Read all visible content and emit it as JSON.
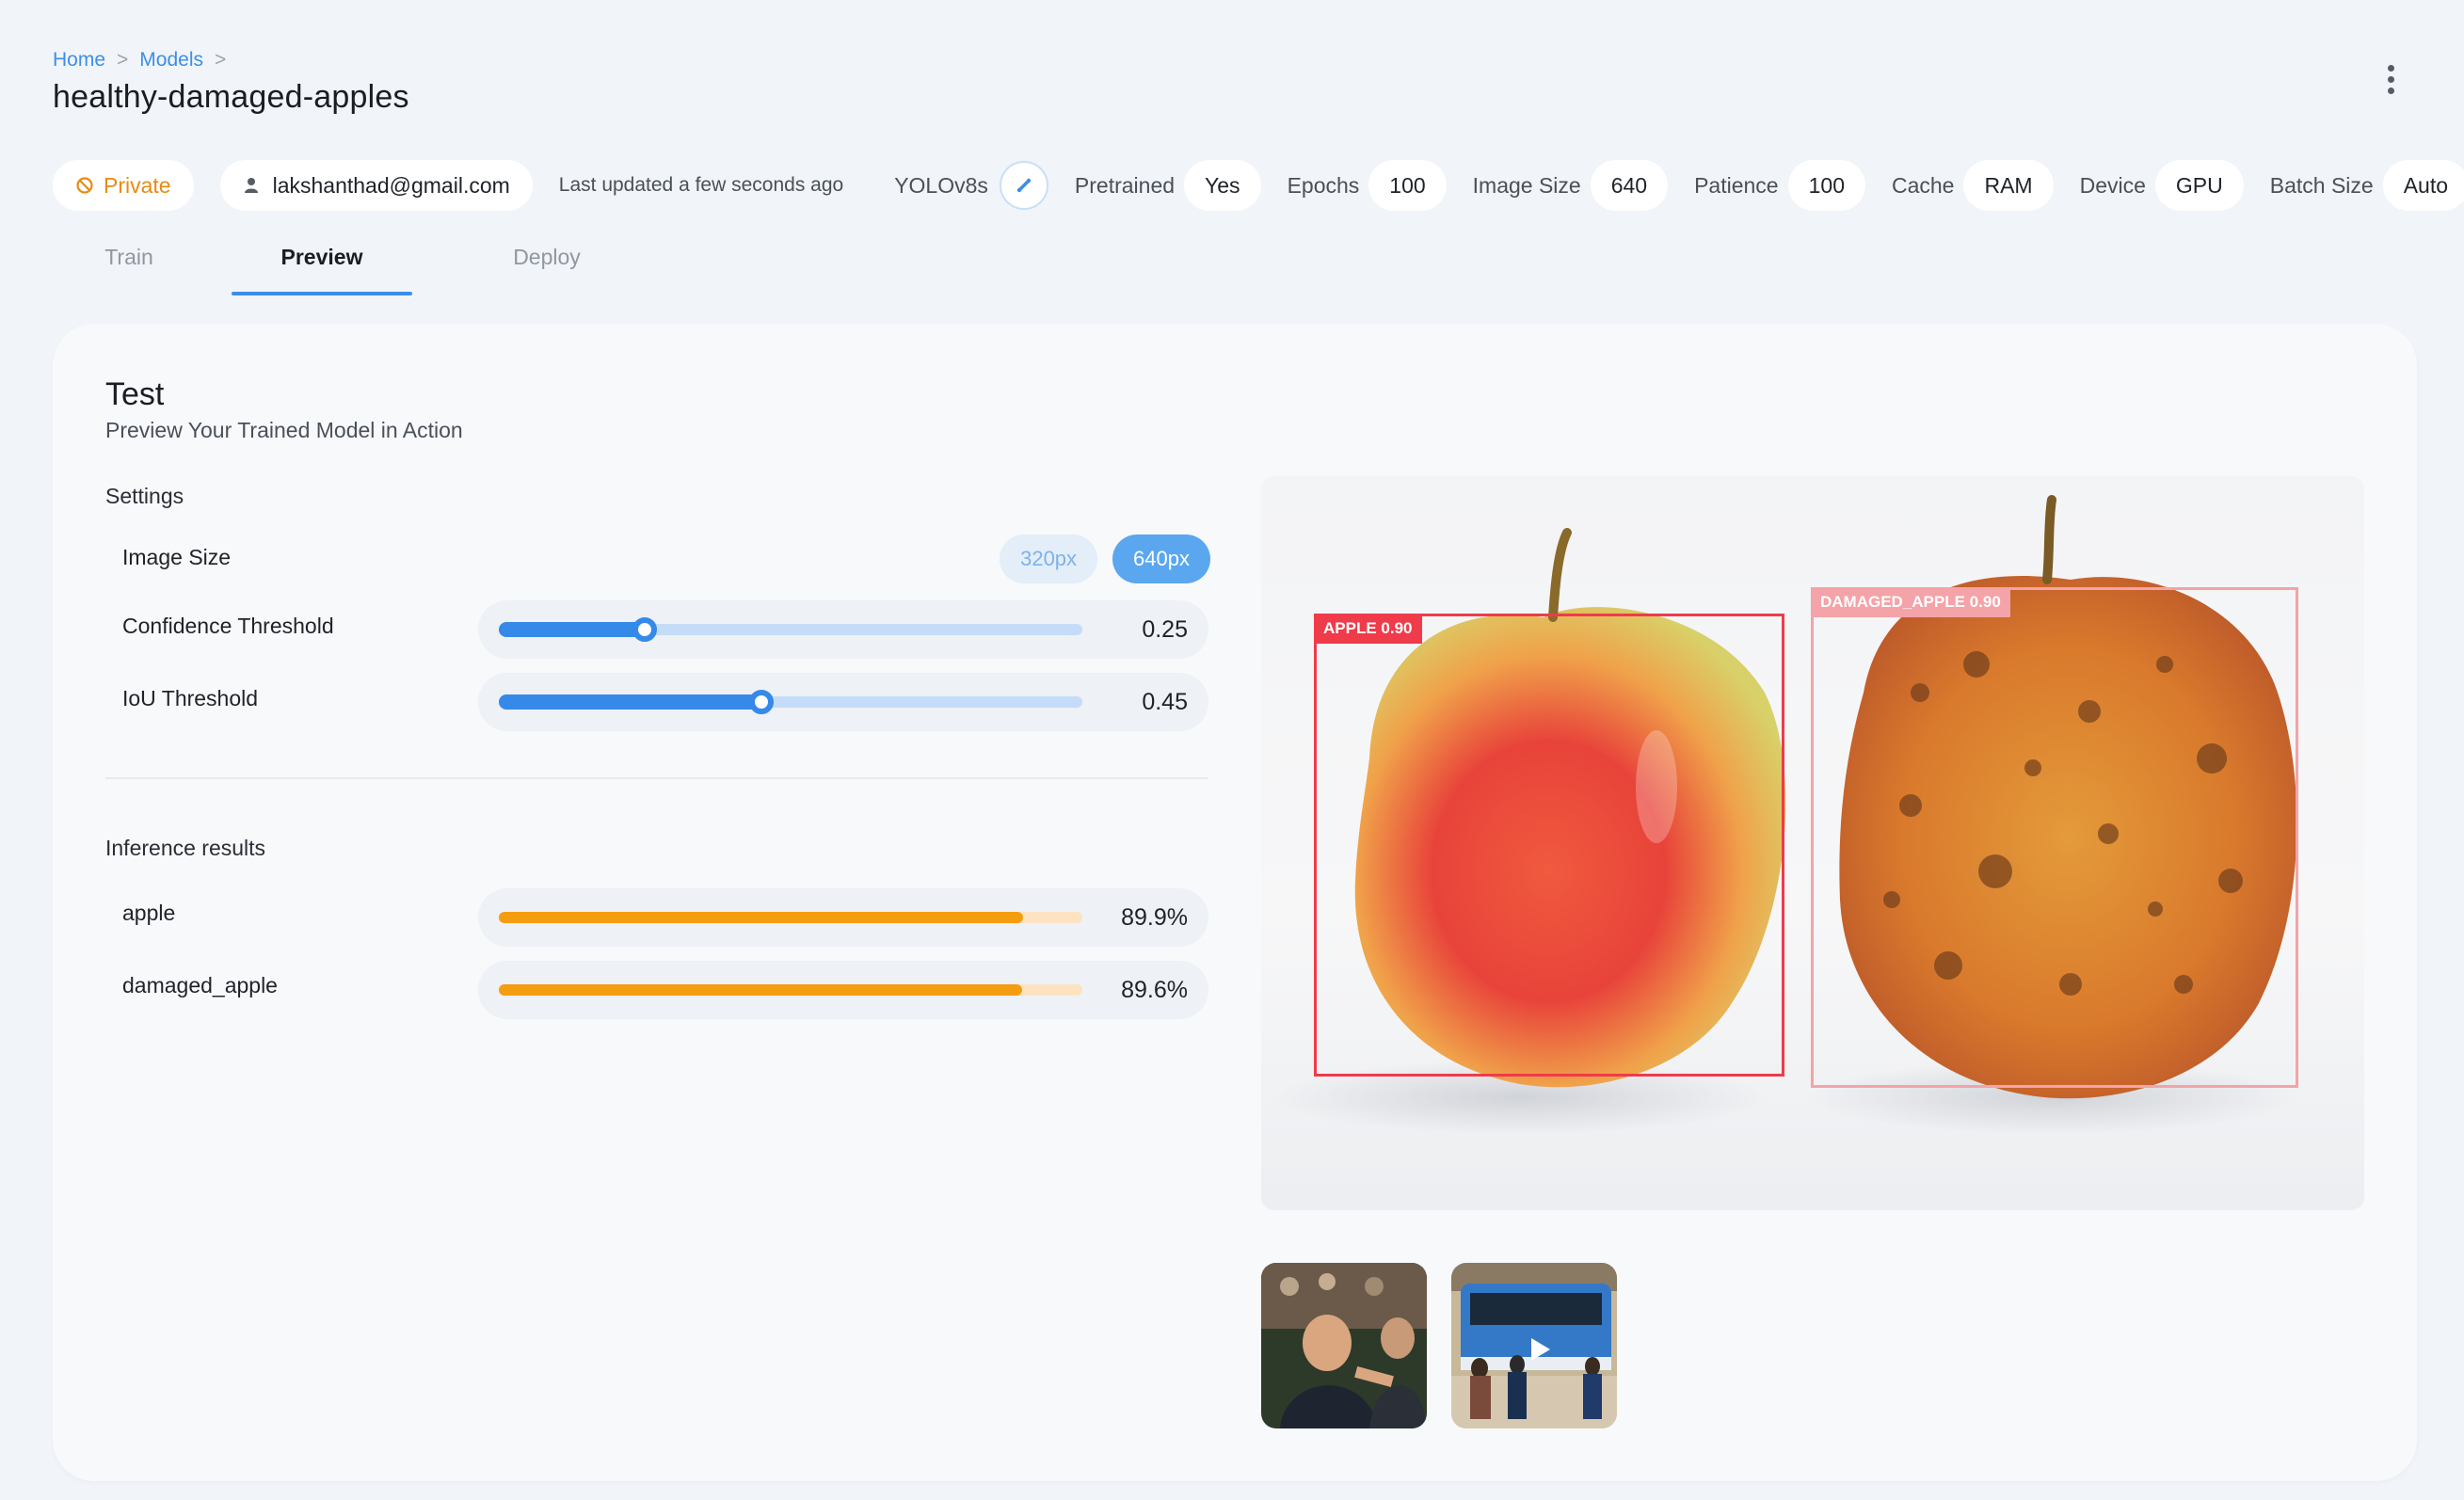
{
  "breadcrumb": {
    "home": "Home",
    "sep1": ">",
    "models": "Models",
    "sep2": ">"
  },
  "page_title": "healthy-damaged-apples",
  "meta": {
    "visibility": "Private",
    "user": "lakshanthad@gmail.com",
    "updated": "Last updated a few seconds ago",
    "model": "YOLOv8s",
    "pretrained_label": "Pretrained",
    "pretrained_value": "Yes",
    "epochs_label": "Epochs",
    "epochs_value": "100",
    "image_size_label": "Image Size",
    "image_size_value": "640",
    "patience_label": "Patience",
    "patience_value": "100",
    "cache_label": "Cache",
    "cache_value": "RAM",
    "device_label": "Device",
    "device_value": "GPU",
    "batch_label": "Batch Size",
    "batch_value": "Auto"
  },
  "tabs": [
    {
      "label": "Train",
      "active": false
    },
    {
      "label": "Preview",
      "active": true
    },
    {
      "label": "Deploy",
      "active": false
    }
  ],
  "card": {
    "title": "Test",
    "subtitle": "Preview Your Trained Model in Action",
    "settings_label": "Settings",
    "image_size_label": "Image Size",
    "image_size_options": [
      "320px",
      "640px"
    ],
    "image_size_selected": "640px",
    "confidence_label": "Confidence Threshold",
    "confidence_value": "0.25",
    "confidence_fraction": 0.25,
    "iou_label": "IoU Threshold",
    "iou_value": "0.45",
    "iou_fraction": 0.45,
    "results_label": "Inference results",
    "results": [
      {
        "name": "apple",
        "value": "89.9%",
        "fraction": 0.899
      },
      {
        "name": "damaged_apple",
        "value": "89.6%",
        "fraction": 0.896
      }
    ]
  },
  "detections": [
    {
      "label": "APPLE 0.90",
      "color": "#ef3b4a"
    },
    {
      "label": "DAMAGED_APPLE 0.90",
      "color": "#f4a3a8"
    }
  ],
  "colors": {
    "accent": "#3b8fe8",
    "private": "#e88a12",
    "bar": "#f59d10"
  },
  "thumbnails": [
    "soccer-scene",
    "street-bus-scene"
  ]
}
